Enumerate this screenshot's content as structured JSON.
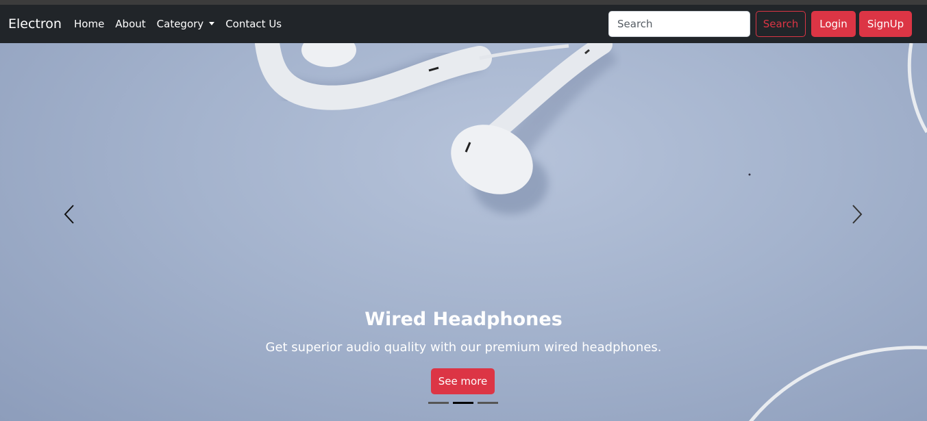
{
  "navbar": {
    "brand": "Electron",
    "links": [
      {
        "label": "Home"
      },
      {
        "label": "About"
      },
      {
        "label": "Category",
        "dropdown": true
      },
      {
        "label": "Contact Us"
      }
    ],
    "search": {
      "placeholder": "Search",
      "value": ""
    },
    "search_button": "Search",
    "login_button": "Login",
    "signup_button": "SignUp"
  },
  "carousel": {
    "active_index": 1,
    "slide_count": 3,
    "caption_title": "Wired Headphones",
    "caption_text": "Get superior audio quality with our premium wired headphones.",
    "caption_button": "See more",
    "icons": {
      "prev": "chevron-left-icon",
      "next": "chevron-right-icon"
    }
  },
  "colors": {
    "navbar_bg": "#212529",
    "accent": "#dc3545",
    "text_light": "#ffffff"
  }
}
